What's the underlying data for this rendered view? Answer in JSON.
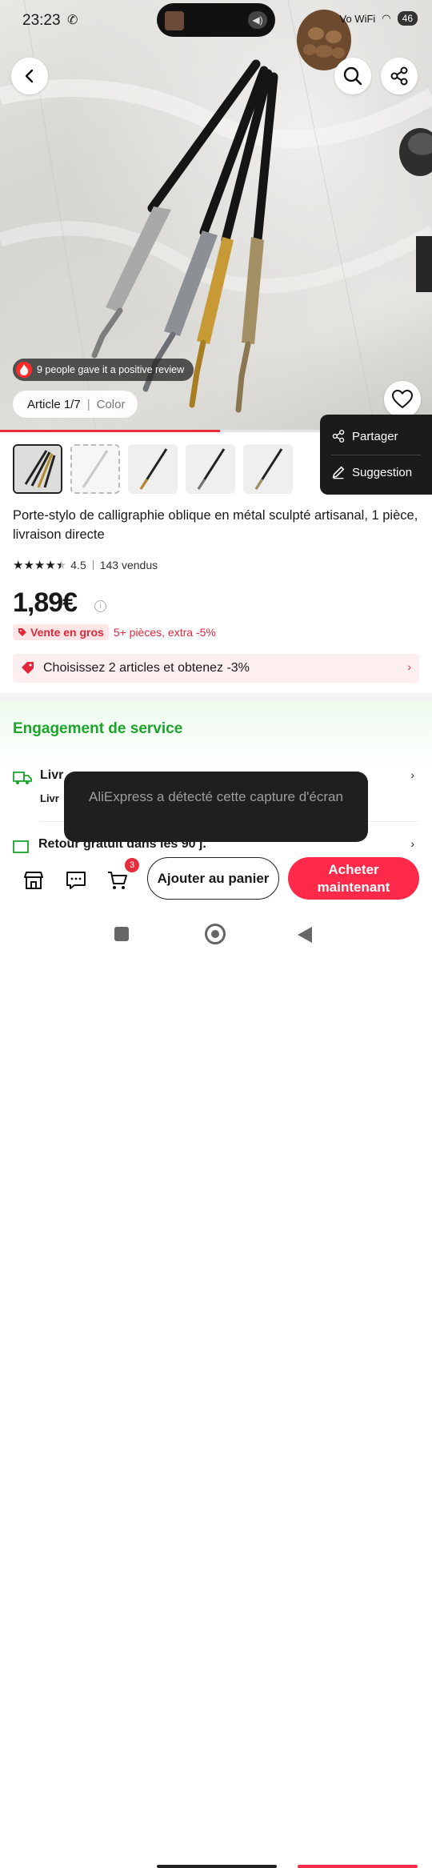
{
  "status_bar": {
    "time": "23:23",
    "network": "Vo WiFi",
    "battery": "46"
  },
  "hero": {
    "review_text": "9 people gave it a positive review",
    "article_counter": "Article 1/7",
    "variant_label": "Color",
    "image_progress": 0.51
  },
  "share_menu": {
    "share_label": "Partager",
    "suggest_label": "Suggestion"
  },
  "product": {
    "title": "Porte-stylo de calligraphie oblique en métal sculpté artisanal, 1 pièce, livraison directe",
    "rating": "4.5",
    "sold": "143 vendus",
    "stars": 4.5,
    "price": "1,89€",
    "bulk_tag": "Vente en gros",
    "bulk_offer": "5+ pièces, extra -5%",
    "coupon_text": "Choisissez 2 articles et obtenez -3%"
  },
  "service": {
    "heading": "Engagement de service",
    "delivery_title": "Livr",
    "delivery_sub": "Livr",
    "return_title": "Retour gratuit dans les 90 j."
  },
  "toast": {
    "message": "AliExpress a détecté cette capture d'écran"
  },
  "actions": {
    "cart_badge": "3",
    "add_to_cart": "Ajouter au panier",
    "buy_now": "Acheter maintenant"
  },
  "colors": {
    "accent": "#ff2a4a",
    "service_green": "#1aa52a",
    "price_red": "#e0283a"
  }
}
